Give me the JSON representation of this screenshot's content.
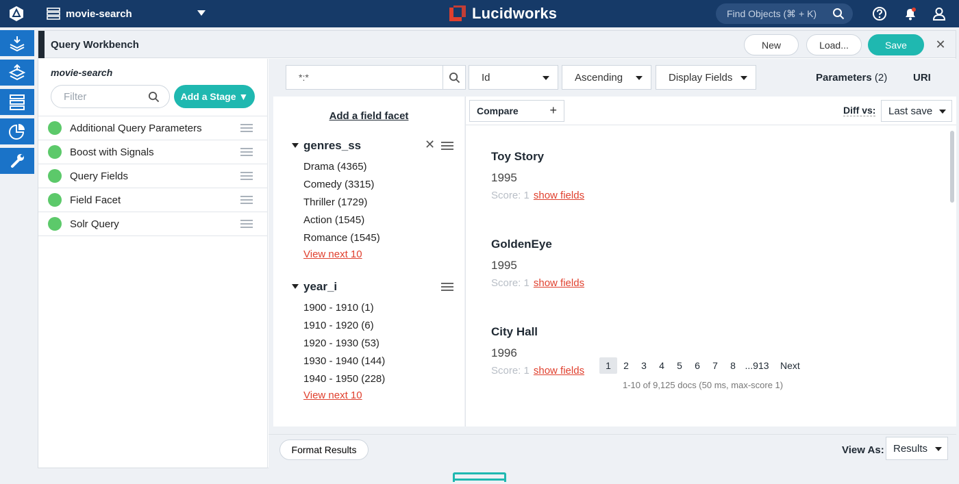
{
  "topbar": {
    "app_name": "movie-search",
    "brand": "Lucidworks",
    "find_placeholder": "Find Objects (⌘ + K)"
  },
  "colors": {
    "topbar": "#163a68",
    "rail": "#1a73c8",
    "accent": "#1fb8b0",
    "link": "#e0402e",
    "stage_ok": "#5cc96a"
  },
  "rail": [
    "index-pipelines-icon",
    "query-pipelines-icon",
    "collections-icon",
    "analytics-icon",
    "system-icon"
  ],
  "header": {
    "title": "Query Workbench",
    "new_label": "New",
    "load_label": "Load...",
    "save_label": "Save",
    "close_label": "✕"
  },
  "stages": {
    "pipeline_name": "movie-search",
    "filter_placeholder": "Filter",
    "add_label": "Add a Stage",
    "items": [
      {
        "label": "Additional Query Parameters"
      },
      {
        "label": "Boost with Signals"
      },
      {
        "label": "Query Fields"
      },
      {
        "label": "Field Facet"
      },
      {
        "label": "Solr Query"
      }
    ]
  },
  "query": {
    "value": "*:*",
    "sort_field": "Id",
    "sort_order": "Ascending",
    "display_fields": "Display Fields",
    "parameters_label": "Parameters",
    "parameters_count": "(2)",
    "uri_label": "URI"
  },
  "facets": {
    "add_label": "Add a field facet",
    "groups": [
      {
        "name": "genres_ss",
        "items": [
          "Drama (4365)",
          "Comedy (3315)",
          "Thriller (1729)",
          "Action (1545)",
          "Romance (1545)"
        ],
        "more": "View next 10"
      },
      {
        "name": "year_i",
        "items": [
          "1900 - 1910 (1)",
          "1910 - 1920 (6)",
          "1920 - 1930 (53)",
          "1930 - 1940 (144)",
          "1940 - 1950 (228)"
        ],
        "more": "View next 10"
      }
    ]
  },
  "results": {
    "compare_label": "Compare",
    "compare_plus": "+",
    "diff_label": "Diff vs:",
    "diff_value": "Last save",
    "docs": [
      {
        "title": "Toy Story",
        "year": "1995",
        "score": "Score: 1",
        "link": "show fields"
      },
      {
        "title": "GoldenEye",
        "year": "1995",
        "score": "Score: 1",
        "link": "show fields"
      },
      {
        "title": "City Hall",
        "year": "1996",
        "score": "Score: 1",
        "link": "show fields"
      }
    ],
    "pages": [
      "1",
      "2",
      "3",
      "4",
      "5",
      "6",
      "7",
      "8",
      "...913"
    ],
    "next_label": "Next",
    "status": "1-10 of 9,125 docs (50 ms, max-score 1)"
  },
  "bottom": {
    "format_label": "Format Results",
    "view_as_label": "View As:",
    "view_as_value": "Results"
  }
}
